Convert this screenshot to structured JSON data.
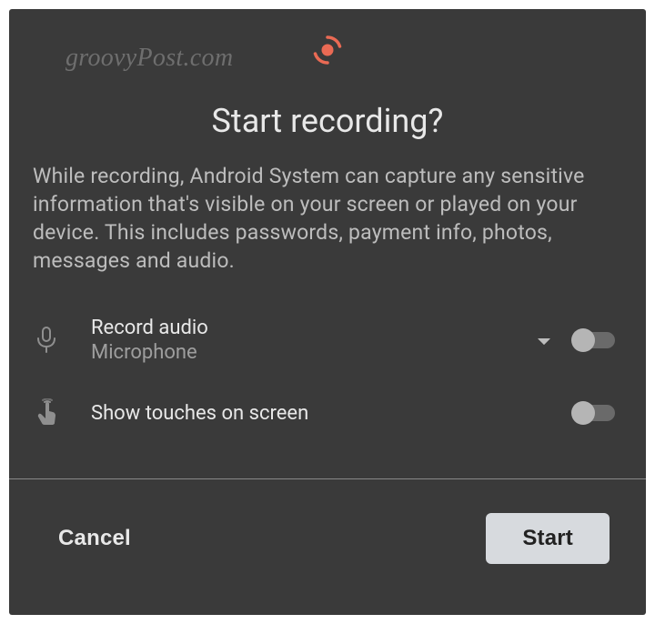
{
  "watermark": "groovyPost.com",
  "dialog": {
    "title": "Start recording?",
    "description": "While recording, Android System can capture any sensitive information that's visible on your screen or played on your device. This includes passwords, payment info, photos, messages and audio."
  },
  "options": {
    "record_audio": {
      "label": "Record audio",
      "sublabel": "Microphone",
      "enabled": false
    },
    "show_touches": {
      "label": "Show touches on screen",
      "enabled": false
    }
  },
  "actions": {
    "cancel_label": "Cancel",
    "start_label": "Start"
  },
  "colors": {
    "accent": "#ea6a54"
  }
}
